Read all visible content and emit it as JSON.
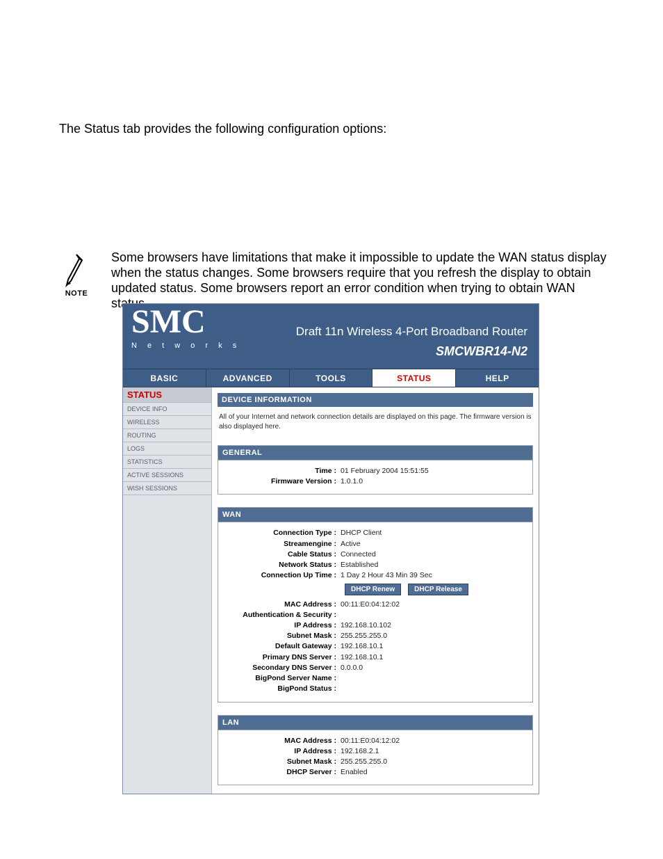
{
  "document": {
    "intro": "The Status tab provides the following configuration options:",
    "note_label": "NOTE",
    "note_text": "Some browsers have limitations that make it impossible to update the WAN status display when the status changes. Some browsers require that you refresh the display to obtain updated status. Some browsers report an error condition when trying to obtain WAN status."
  },
  "router": {
    "logo_big": "SMC",
    "logo_small": "N e t w o r k s",
    "title": "Draft 11n Wireless 4-Port Broadband Router",
    "model": "SMCWBR14-N2",
    "tabs": {
      "basic": "BASIC",
      "advanced": "ADVANCED",
      "tools": "TOOLS",
      "status": "STATUS",
      "help": "HELP"
    },
    "sidebar": {
      "title": "STATUS",
      "items": [
        "DEVICE INFO",
        "WIRELESS",
        "ROUTING",
        "LOGS",
        "STATISTICS",
        "ACTIVE SESSIONS",
        "WISH SESSIONS"
      ]
    },
    "sections": {
      "device_info": {
        "header": "DEVICE INFORMATION",
        "desc": "All of your Internet and network connection details are displayed on this page. The firmware version is also displayed here."
      },
      "general": {
        "header": "GENERAL",
        "rows": {
          "time_k": "Time :",
          "time_v": "01 February 2004 15:51:55",
          "fw_k": "Firmware Version :",
          "fw_v": "1.0.1.0"
        }
      },
      "wan": {
        "header": "WAN",
        "rows": {
          "conn_type_k": "Connection Type :",
          "conn_type_v": "DHCP Client",
          "se_k": "Streamengine :",
          "se_v": "Active",
          "cable_k": "Cable Status :",
          "cable_v": "Connected",
          "net_k": "Network Status :",
          "net_v": "Established",
          "uptime_k": "Connection Up Time :",
          "uptime_v": "1 Day 2 Hour 43 Min 39 Sec",
          "mac_k": "MAC Address :",
          "mac_v": "00:11:E0:04:12:02",
          "auth_k": "Authentication & Security :",
          "auth_v": "",
          "ip_k": "IP Address :",
          "ip_v": "192.168.10.102",
          "mask_k": "Subnet Mask :",
          "mask_v": "255.255.255.0",
          "gw_k": "Default Gateway :",
          "gw_v": "192.168.10.1",
          "pdns_k": "Primary DNS Server :",
          "pdns_v": "192.168.10.1",
          "sdns_k": "Secondary DNS Server :",
          "sdns_v": "0.0.0.0",
          "bpn_k": "BigPond Server Name :",
          "bpn_v": "",
          "bps_k": "BigPond Status :",
          "bps_v": ""
        },
        "buttons": {
          "renew": "DHCP Renew",
          "release": "DHCP Release"
        }
      },
      "lan": {
        "header": "LAN",
        "rows": {
          "mac_k": "MAC Address :",
          "mac_v": "00:11:E0:04:12:02",
          "ip_k": "IP Address :",
          "ip_v": "192.168.2.1",
          "mask_k": "Subnet Mask :",
          "mask_v": "255.255.255.0",
          "dhcp_k": "DHCP Server :",
          "dhcp_v": "Enabled"
        }
      }
    }
  }
}
